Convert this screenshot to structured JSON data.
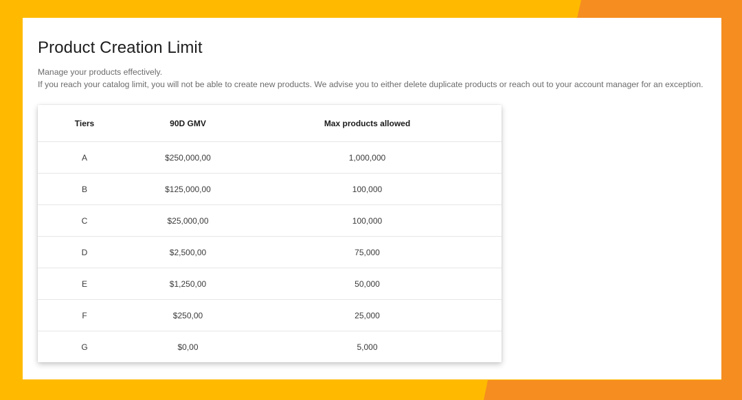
{
  "colors": {
    "background_yellow": "#FFBA00",
    "background_orange": "#F68D20",
    "panel": "#FFFFFF"
  },
  "page": {
    "title": "Product Creation Limit",
    "description_line1": "Manage your products effectively.",
    "description_line2": "If you reach your catalog limit, you will not be able to create new products. We advise you to either delete duplicate products or reach out to your account manager for an exception."
  },
  "table": {
    "headers": {
      "tiers": "Tiers",
      "gmv": "90D GMV",
      "max_products": "Max products allowed"
    },
    "rows": [
      {
        "tier": "A",
        "gmv": "$250,000,00",
        "max": "1,000,000"
      },
      {
        "tier": "B",
        "gmv": "$125,000,00",
        "max": "100,000"
      },
      {
        "tier": "C",
        "gmv": "$25,000,00",
        "max": "100,000"
      },
      {
        "tier": "D",
        "gmv": "$2,500,00",
        "max": "75,000"
      },
      {
        "tier": "E",
        "gmv": "$1,250,00",
        "max": "50,000"
      },
      {
        "tier": "F",
        "gmv": "$250,00",
        "max": "25,000"
      },
      {
        "tier": "G",
        "gmv": "$0,00",
        "max": "5,000"
      }
    ]
  }
}
